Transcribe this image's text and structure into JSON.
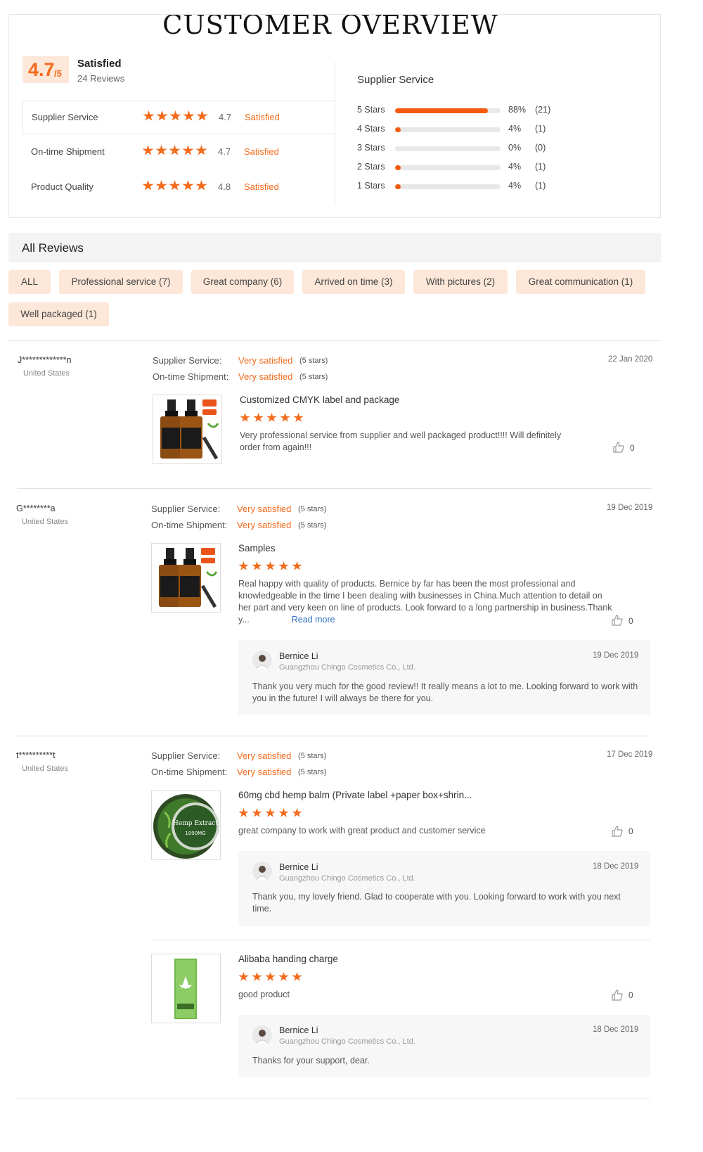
{
  "page_title": "CUSTOMER OVERVIEW",
  "overview": {
    "score": "4.7",
    "score_suffix": "/5",
    "label": "Satisfied",
    "reviews": "24 Reviews",
    "ratings": [
      {
        "label": "Supplier Service",
        "score": "4.7",
        "status": "Satisfied"
      },
      {
        "label": "On-time Shipment",
        "score": "4.7",
        "status": "Satisfied"
      },
      {
        "label": "Product Quality",
        "score": "4.8",
        "status": "Satisfied"
      }
    ],
    "distribution_title": "Supplier Service",
    "distribution": [
      {
        "label": "5  Stars",
        "percent": 88,
        "pct_text": "88%",
        "count": "(21)"
      },
      {
        "label": "4  Stars",
        "percent": 4,
        "pct_text": "4%",
        "count": "(1)"
      },
      {
        "label": "3  Stars",
        "percent": 0,
        "pct_text": "0%",
        "count": "(0)"
      },
      {
        "label": "2  Stars",
        "percent": 4,
        "pct_text": "4%",
        "count": "(1)"
      },
      {
        "label": "1  Stars",
        "percent": 4,
        "pct_text": "4%",
        "count": "(1)"
      }
    ]
  },
  "all_reviews": {
    "title": "All Reviews",
    "tags": [
      "ALL",
      "Professional service (7)",
      "Great company (6)",
      "Arrived on time (3)",
      "With pictures (2)",
      "Great communication (1)",
      "Well packaged (1)"
    ]
  },
  "labels": {
    "supplier_service": "Supplier Service:",
    "ontime_shipment": "On-time Shipment:",
    "very_satisfied": "Very satisfied",
    "five_stars": "(5 stars)",
    "read_more": "Read more"
  },
  "reviews": [
    {
      "user": "J*************n",
      "country": "United States",
      "date": "22 Jan 2020",
      "title": "Customized CMYK label and package",
      "stars": 5,
      "text": "Very professional service from supplier and well packaged product!!!!  Will definitely order from again!!!",
      "likes": "0"
    },
    {
      "user": "G********a",
      "country": "United States",
      "date": "19 Dec 2019",
      "title": "Samples",
      "stars": 5,
      "text": "Real happy with quality of products.  Bernice by far has been the most professional and knowledgeable in the time I been dealing with businesses in China.Much attention to detail on her part and very keen on line of products. Look forward to a long partnership in business.Thank y...",
      "likes": "0",
      "reply": {
        "name": "Bernice Li",
        "company": "Guangzhou Chingo Cosmetics Co., Ltd.",
        "date": "19 Dec 2019",
        "text": "Thank you very much for the good review!! It really means a lot to me. Looking forward to work with you in the future!   I will always be there for you."
      }
    },
    {
      "user": "t**********t",
      "country": "United States",
      "date": "17 Dec 2019",
      "title": "60mg cbd hemp balm (Private label +paper box+shrin...",
      "stars": 5,
      "text": "great company to work with great product and customer service",
      "likes": "0",
      "thumb_text": "Hemp Extract",
      "thumb_sub": "1000MG",
      "reply": {
        "name": "Bernice Li",
        "company": "Guangzhou Chingo Cosmetics Co., Ltd.",
        "date": "18 Dec 2019",
        "text": "Thank you, my lovely friend. Glad to cooperate with you. Looking forward to work with you next time."
      }
    },
    {
      "title": "Alibaba handing charge",
      "stars": 5,
      "text": "good product",
      "likes": "0",
      "reply": {
        "name": "Bernice Li",
        "company": "Guangzhou Chingo Cosmetics Co., Ltd.",
        "date": "18 Dec 2019",
        "text": "Thanks for your support, dear."
      }
    }
  ],
  "colors": {
    "accent": "#f36b1c",
    "bar": "#f35a0e",
    "tag_bg": "#fde7d8",
    "link": "#2f6fc8"
  }
}
